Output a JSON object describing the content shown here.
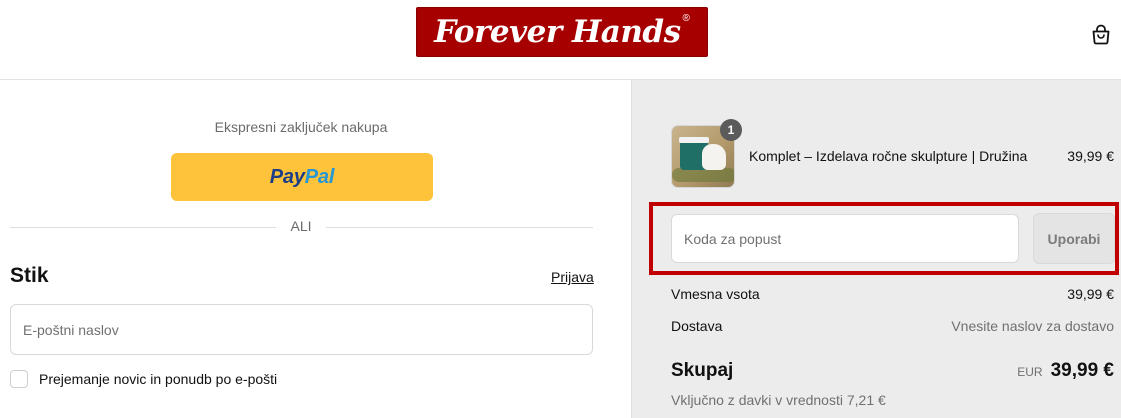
{
  "header": {
    "logo_text": "Forever Hands",
    "logo_reg": "®",
    "logo_color": "#a60000",
    "cart_icon": "shopping-bag-icon"
  },
  "express": {
    "label": "Ekspresni zaključek nakupa",
    "paypal_dark": "Pay",
    "paypal_light": "Pal",
    "paypal_color": "#fec33a"
  },
  "divider": {
    "label": "ALI"
  },
  "contact": {
    "title": "Stik",
    "login_label": "Prijava",
    "email_placeholder": "E-poštni naslov",
    "newsletter_label": "Prejemanje novic in ponudb po e-pošti"
  },
  "summary": {
    "item": {
      "quantity": "1",
      "name": "Komplet – Izdelava ročne skulpture | Družina",
      "price": "39,99 €"
    },
    "discount": {
      "placeholder": "Koda za popust",
      "apply_label": "Uporabi",
      "highlight_color": "#c00000"
    },
    "subtotal": {
      "label": "Vmesna vsota",
      "value": "39,99 €"
    },
    "shipping": {
      "label": "Dostava",
      "value": "Vnesite naslov za dostavo"
    },
    "total": {
      "label": "Skupaj",
      "currency": "EUR",
      "value": "39,99 €"
    },
    "tax_note": "Vključno z davki v vrednosti 7,21 €"
  }
}
